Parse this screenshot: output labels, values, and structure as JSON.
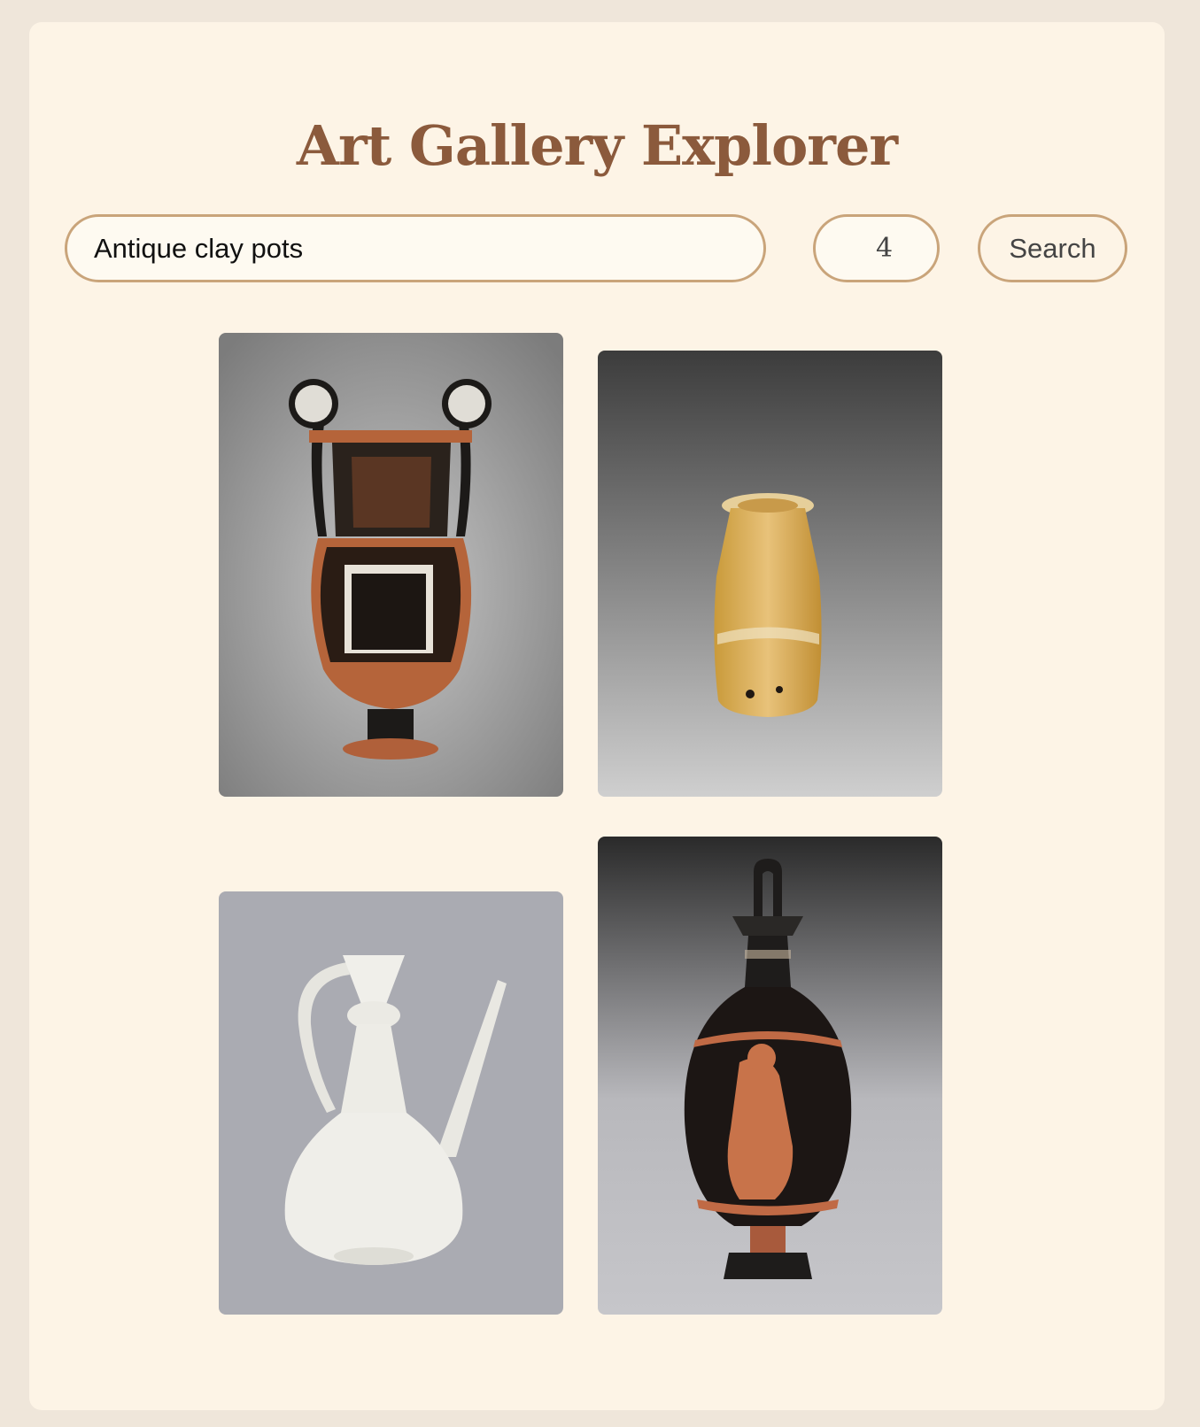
{
  "app": {
    "title": "Art Gallery Explorer"
  },
  "search": {
    "query": "Antique clay pots",
    "count": "4",
    "button_label": "Search"
  },
  "colors": {
    "title": "#8b5a3c",
    "border": "#c9a47a",
    "card_bg": "#fdf4e6",
    "page_bg": "#efe6da"
  },
  "results": [
    {
      "subject": "red-figure volute krater"
    },
    {
      "subject": "glass alabastron"
    },
    {
      "subject": "white porcelain ewer"
    },
    {
      "subject": "red-figure lekythos"
    }
  ]
}
